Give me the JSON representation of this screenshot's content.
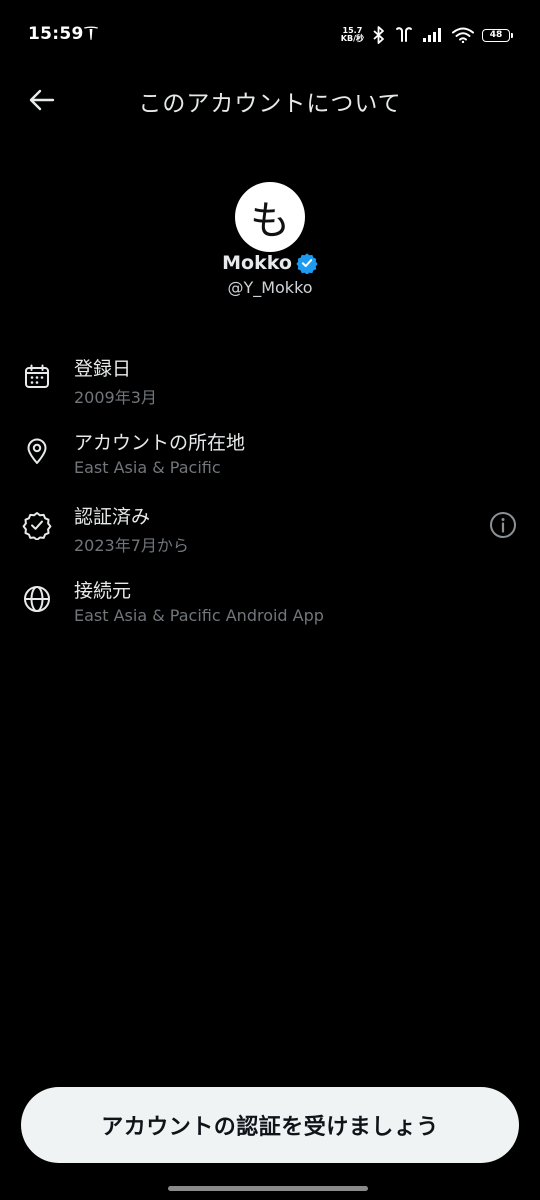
{
  "status_bar": {
    "time": "15:59",
    "net_speed_value": "15.7",
    "net_speed_unit": "KB/秒",
    "battery": "48"
  },
  "header": {
    "title": "このアカウントについて",
    "back_icon": "arrow-left-icon"
  },
  "profile": {
    "avatar_glyph": "も",
    "display_name": "Mokko",
    "handle": "@Y_Mokko",
    "verified_color": "#1d9bf0"
  },
  "info_items": [
    {
      "icon": "calendar-icon",
      "title": "登録日",
      "subtitle": "2009年3月"
    },
    {
      "icon": "location-pin-icon",
      "title": "アカウントの所在地",
      "subtitle": "East Asia & Pacific"
    },
    {
      "icon": "verified-badge-outline-icon",
      "title": "認証済み",
      "subtitle": "2023年7月から"
    },
    {
      "icon": "globe-icon",
      "title": "接続元",
      "subtitle": "East Asia & Pacific Android App"
    }
  ],
  "colors": {
    "background": "#000000",
    "primary_text": "#e7e9ea",
    "secondary_text": "#71767b",
    "button_bg": "#eff3f4"
  },
  "cta": {
    "label": "アカウントの認証を受けましょう"
  }
}
